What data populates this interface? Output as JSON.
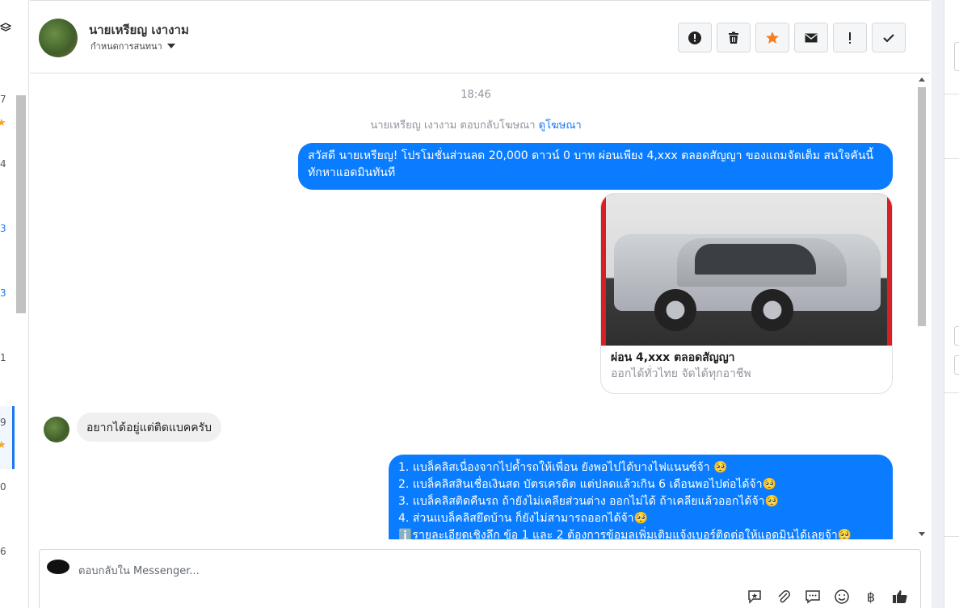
{
  "left_list": {
    "numbers": [
      "7",
      "4",
      "3",
      "3",
      "1",
      "9",
      "0",
      "6"
    ]
  },
  "header": {
    "name": "นายเหรียญ เงางาม",
    "status_label": "กำหนดการสนทนา",
    "actions": [
      "mark-important-icon",
      "trash-icon",
      "star-icon",
      "envelope-icon",
      "exclamation-icon",
      "check-icon"
    ],
    "star_color": "#f48024"
  },
  "chat": {
    "timestamp": "18:46",
    "reply_note": "นายเหรียญ เงางาม ตอบกลับโฆษณา",
    "reply_link": "ดูโฆษณา",
    "outgoing_1": "สวัสดี นายเหรียญ! โปรโมชั่นส่วนลด 20,000 ดาวน์ 0 บาท ผ่อนเพียง 4,xxx ตลอดสัญญา ของแถมจัดเต็ม สนใจคันนี้ทักหาแอดมินทันที",
    "card": {
      "title": "ผ่อน 4,xxx ตลอดสัญญา",
      "description": "ออกได้ทั่วไทย จัดได้ทุกอาชีพ"
    },
    "incoming_1": "อยากได้อยู่แต่ติดแบคครับ",
    "outgoing_2_lines": [
      "1. แบล็คลิสเนื่องจากไปค้ำรถให้เพื่อน ยังพอไปได้บางไฟแนนซ์จ้า 🥺",
      "2. แบล็คลิสสินเชื่อเงินสด บัตรเครดิต แต่ปลดแล้วเกิน 6 เดือนพอไปต่อได้จ้า🥺",
      "3. แบล็คลิสติดคืนรถ ถ้ายังไม่เคลียส่วนต่าง ออกไม่ได้ ถ้าเคลียแล้วออกได้จ้า🥺",
      "4. ส่วนแบล็คลิสยึดบ้าน ก็ยังไม่สามารถออกได้จ้า🥺",
      "ℹ️รายละเอียดเชิงลึก ข้อ 1 และ 2 ต้องการข้อมูลเพิ่มเติมแจ้งเบอร์ติดต่อให้แอดมินได้เลยจ้า🥺"
    ],
    "bubble_color": "#0a7cff"
  },
  "composer": {
    "placeholder": "ตอบกลับใน Messenger...",
    "tools": [
      "saved-reply-icon",
      "attachment-icon",
      "chat-icon",
      "emoji-icon",
      "baht-icon",
      "like-icon"
    ]
  }
}
